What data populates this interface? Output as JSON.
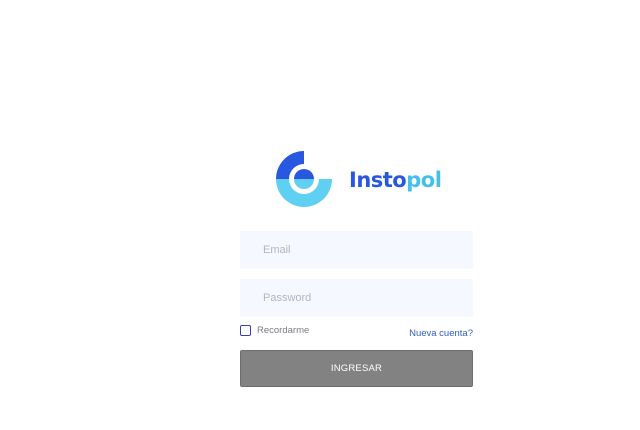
{
  "brand": {
    "name_part1": "Insto",
    "name_part2": "pol",
    "logo_icon": "instopol-logo-icon",
    "colors": {
      "primary_blue": "#2857e0",
      "light_blue": "#46c0ea",
      "sky_blue": "#5fcff2"
    }
  },
  "login_form": {
    "email": {
      "placeholder": "Email",
      "value": ""
    },
    "password": {
      "placeholder": "Password",
      "value": ""
    },
    "remember": {
      "label": "Recordarme",
      "checked": false
    },
    "new_account_link": "Nueva cuenta?",
    "submit_label": "INGRESAR",
    "submit_color": "#828282"
  }
}
